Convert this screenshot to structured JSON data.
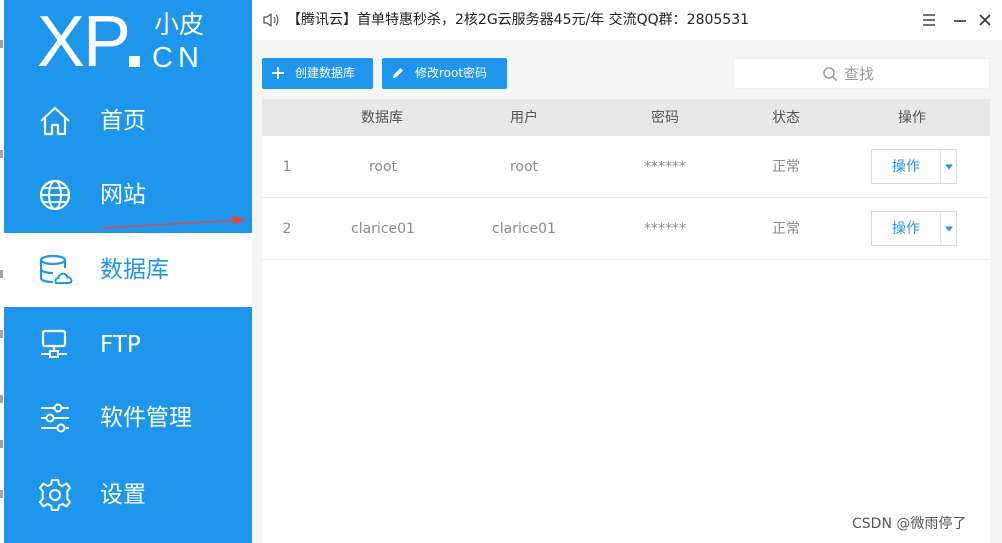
{
  "logo": {
    "main": "XP",
    "cn_top": "小皮",
    "cn_bottom": "CN"
  },
  "sidebar": {
    "items": [
      {
        "label": "首页",
        "icon": "home-icon",
        "active": false
      },
      {
        "label": "网站",
        "icon": "globe-icon",
        "active": false
      },
      {
        "label": "数据库",
        "icon": "database-icon",
        "active": true
      },
      {
        "label": "FTP",
        "icon": "ftp-server-icon",
        "active": false
      },
      {
        "label": "软件管理",
        "icon": "sliders-icon",
        "active": false
      },
      {
        "label": "设置",
        "icon": "gear-icon",
        "active": false
      }
    ]
  },
  "titlebar": {
    "announcement": "【腾讯云】首单特惠秒杀，2核2G云服务器45元/年 交流QQ群：2805531"
  },
  "toolbar": {
    "create_label": "创建数据库",
    "modify_label": "修改root密码"
  },
  "search": {
    "placeholder": "查找",
    "value": ""
  },
  "table": {
    "headers": [
      "数据库",
      "用户",
      "密码",
      "状态",
      "操作"
    ],
    "rows": [
      {
        "index": "1",
        "database": "root",
        "user": "root",
        "password": "******",
        "status": "正常",
        "action": "操作"
      },
      {
        "index": "2",
        "database": "clarice01",
        "user": "clarice01",
        "password": "******",
        "status": "正常",
        "action": "操作"
      }
    ]
  },
  "watermark": "CSDN @微雨停了",
  "colors": {
    "accent": "#1e96eb",
    "sidebar_bg": "#1e96eb",
    "header_bg": "#e8e8e8",
    "arrow": "#e04848"
  }
}
